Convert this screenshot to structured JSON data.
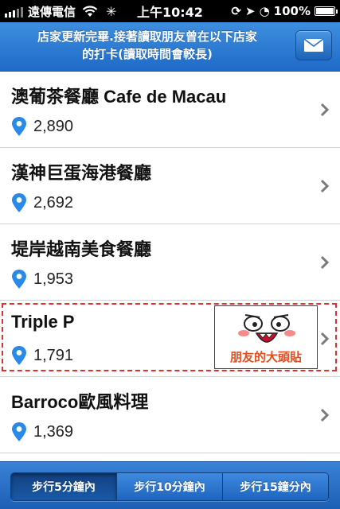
{
  "status_bar": {
    "carrier": "遠傳電信",
    "time": "上午10:42",
    "battery": "100%",
    "battery_level": 1.0
  },
  "banner": {
    "message": "店家更新完畢.接著讀取朋友曾在以下店家的打卡(讀取時間會較長)",
    "mail_icon": "envelope-icon"
  },
  "restaurants": [
    {
      "name": "澳葡茶餐廳 Cafe de Macau",
      "distance": "2,890"
    },
    {
      "name": "漢神巨蛋海港餐廳",
      "distance": "2,692"
    },
    {
      "name": "堤岸越南美食餐廳",
      "distance": "1,953"
    },
    {
      "name": "Triple P",
      "distance": "1,791"
    },
    {
      "name": "Barroco歐風料理",
      "distance": "1,369"
    }
  ],
  "sticker": {
    "caption": "朋友的大頭貼"
  },
  "tabs": [
    {
      "label": "步行5分鐘內",
      "active": true
    },
    {
      "label": "步行10分鐘內",
      "active": false
    },
    {
      "label": "步行15鐘分內",
      "active": false
    }
  ],
  "colors": {
    "accent_blue": "#1f6ac7",
    "pin_blue": "#2a8ae8",
    "highlight_red": "#e0302e"
  }
}
